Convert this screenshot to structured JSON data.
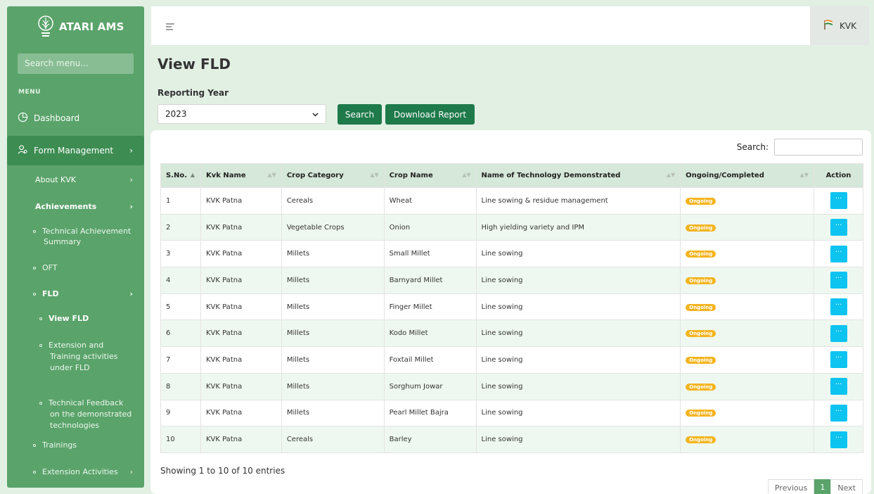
{
  "brand": {
    "title": "ATARI AMS"
  },
  "sidebar": {
    "search_placeholder": "Search menu...",
    "menu_label": "MENU",
    "dashboard": "Dashboard",
    "form_management": "Form Management",
    "items": {
      "about_kvk": "About KVK",
      "achievements": "Achievements",
      "technical_achievement": "Technical Achievement",
      "technical_achievement_2": "Summary",
      "oft": "OFT",
      "fld": "FLD",
      "view_fld": "View FLD",
      "ext_1": "Extension and",
      "ext_2": "Training activities",
      "ext_3": "under FLD",
      "tf_1": "Technical Feedback",
      "tf_2": "on the demonstrated",
      "tf_3": "technologies",
      "trainings": "Trainings",
      "extension_activities": "Extension Activities"
    }
  },
  "topbar": {
    "user_label": "KVK"
  },
  "page": {
    "title": "View FLD",
    "reporting_year_label": "Reporting Year",
    "selected_year": "2023",
    "search_button": "Search",
    "download_button": "Download Report"
  },
  "table": {
    "search_label": "Search:",
    "columns": [
      "S.No.",
      "Kvk Name",
      "Crop Category",
      "Crop Name",
      "Name of Technology Demonstrated",
      "Ongoing/Completed",
      "Action"
    ],
    "rows": [
      [
        "1",
        "KVK Patna",
        "Cereals",
        "Wheat",
        "Line sowing & residue management",
        "Ongoing"
      ],
      [
        "2",
        "KVK Patna",
        "Vegetable Crops",
        "Onion",
        "High yielding variety and IPM",
        "Ongoing"
      ],
      [
        "3",
        "KVK Patna",
        "Millets",
        "Small Millet",
        "Line sowing",
        "Ongoing"
      ],
      [
        "4",
        "KVK Patna",
        "Millets",
        "Barnyard Millet",
        "Line sowing",
        "Ongoing"
      ],
      [
        "5",
        "KVK Patna",
        "Millets",
        "Finger Millet",
        "Line sowing",
        "Ongoing"
      ],
      [
        "6",
        "KVK Patna",
        "Millets",
        "Kodo Millet",
        "Line sowing",
        "Ongoing"
      ],
      [
        "7",
        "KVK Patna",
        "Millets",
        "Foxtail Millet",
        "Line sowing",
        "Ongoing"
      ],
      [
        "8",
        "KVK Patna",
        "Millets",
        "Sorghum Jowar",
        "Line sowing",
        "Ongoing"
      ],
      [
        "9",
        "KVK Patna",
        "Millets",
        "Pearl Millet Bajra",
        "Line sowing",
        "Ongoing"
      ],
      [
        "10",
        "KVK Patna",
        "Cereals",
        "Barley",
        "Line sowing",
        "Ongoing"
      ]
    ],
    "action_glyph": "···",
    "showing_text": "Showing 1 to 10 of 10 entries",
    "pager": {
      "previous": "Previous",
      "current": "1",
      "next": "Next"
    }
  },
  "colors": {
    "sidebar": "#5aa36a",
    "primary_button": "#1e7a4a",
    "badge": "#f4b41e",
    "action": "#0dc3f0"
  }
}
